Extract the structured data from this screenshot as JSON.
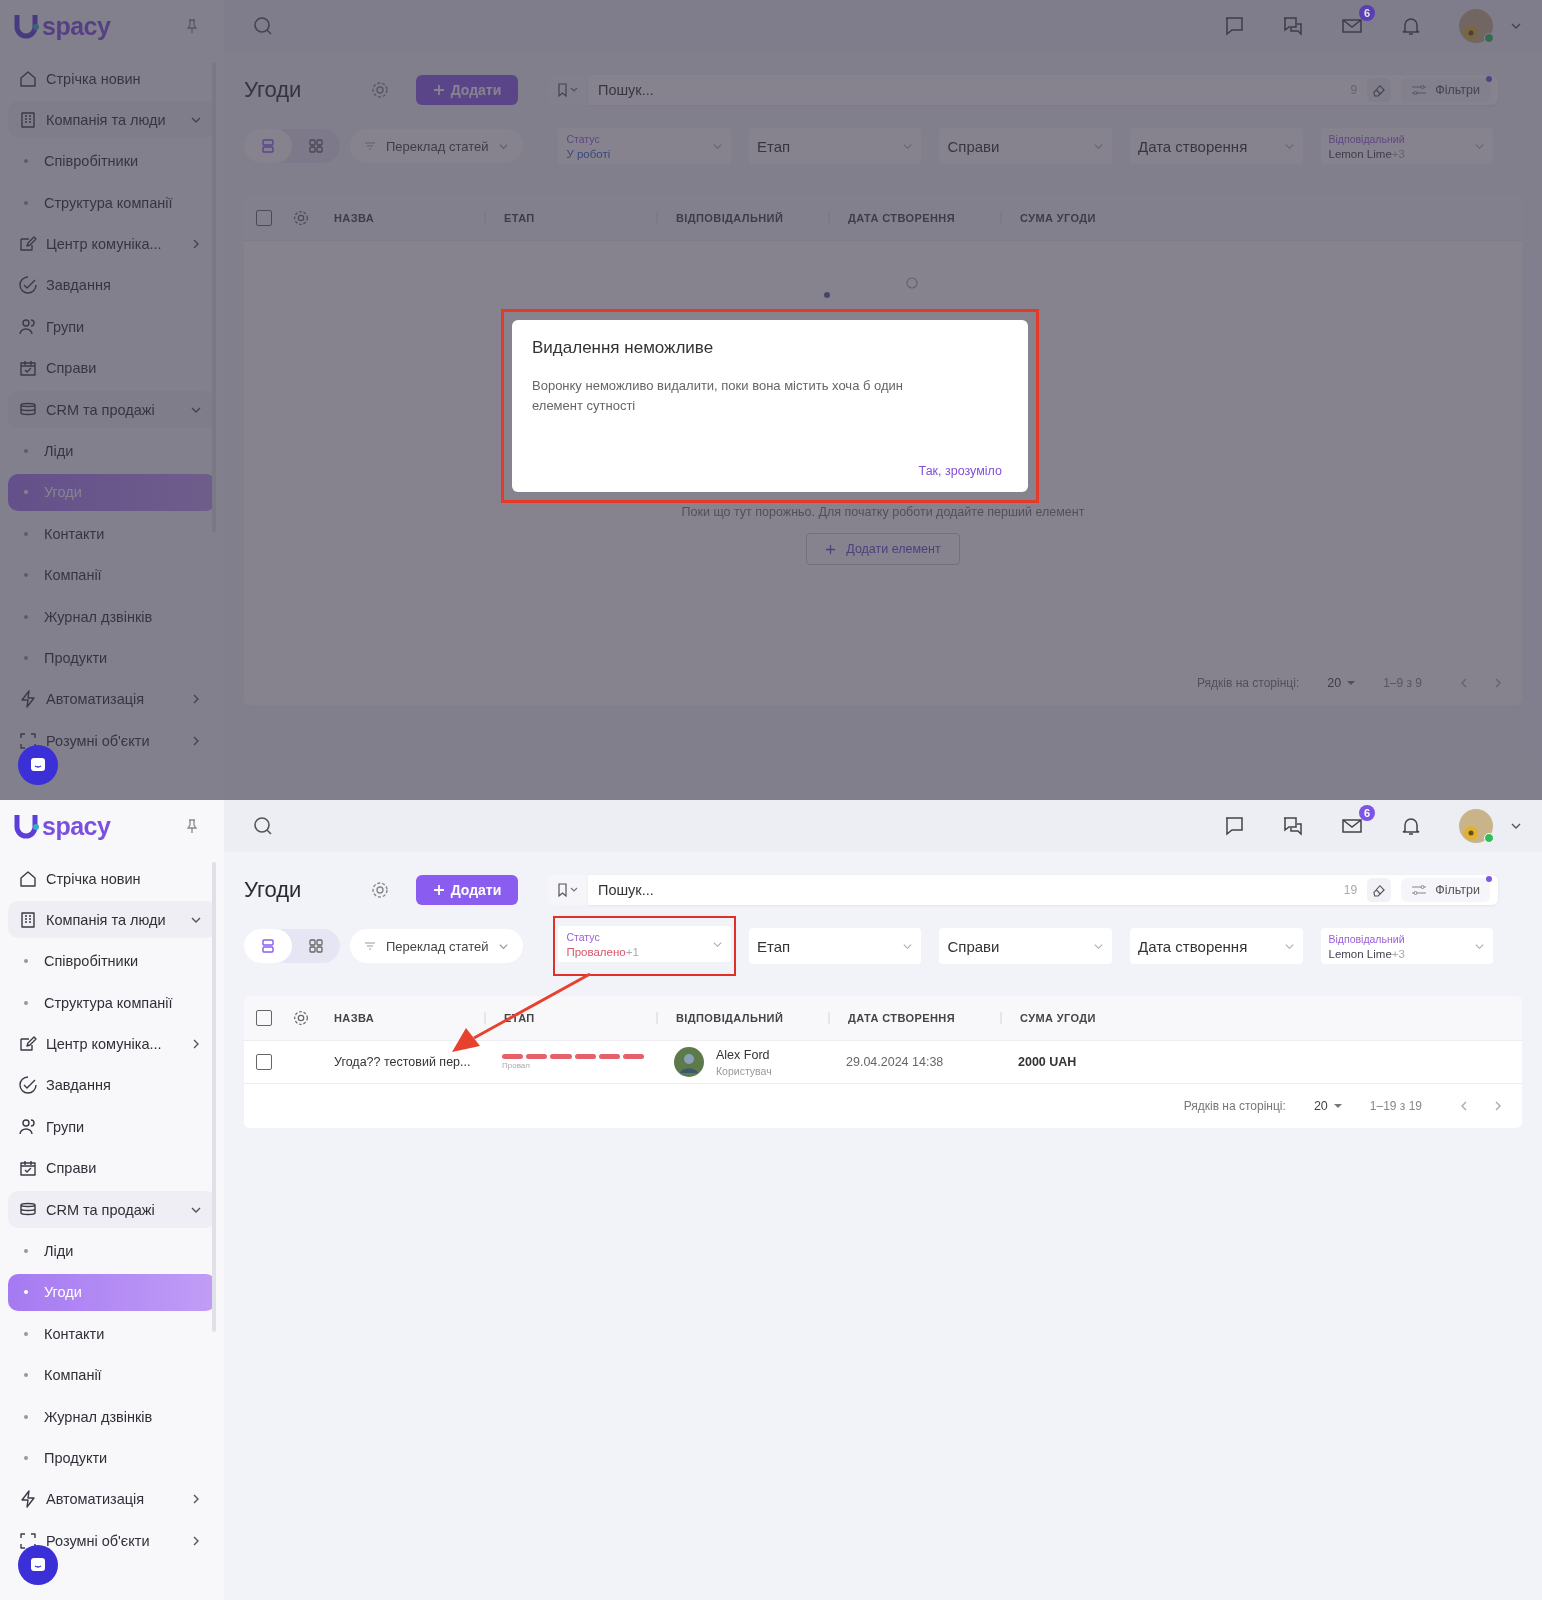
{
  "screens": [
    {
      "dimmed": true,
      "logo": {
        "text": "spacy"
      },
      "sidebar": {
        "items": [
          {
            "kind": "link",
            "label": "Стрічка новин",
            "selected": false
          },
          {
            "kind": "group",
            "label": "Компанія та люди",
            "expanded": true,
            "selected": false
          },
          {
            "kind": "sub",
            "label": "Співробітники",
            "selected": false
          },
          {
            "kind": "sub",
            "label": "Структура компанії",
            "selected": false
          },
          {
            "kind": "group",
            "label": "Центр комуніка...",
            "expanded": false,
            "selected": false
          },
          {
            "kind": "link",
            "label": "Завдання",
            "selected": false
          },
          {
            "kind": "link",
            "label": "Групи",
            "selected": false
          },
          {
            "kind": "link",
            "label": "Справи",
            "selected": false
          },
          {
            "kind": "group",
            "label": "CRM та продажі",
            "expanded": true,
            "selected": false
          },
          {
            "kind": "sub",
            "label": "Ліди",
            "selected": false
          },
          {
            "kind": "sub",
            "label": "Угоди",
            "selected": true
          },
          {
            "kind": "sub",
            "label": "Контакти",
            "selected": false
          },
          {
            "kind": "sub",
            "label": "Компанії",
            "selected": false
          },
          {
            "kind": "sub",
            "label": "Журнал дзвінків",
            "selected": false
          },
          {
            "kind": "sub",
            "label": "Продукти",
            "selected": false
          },
          {
            "kind": "group",
            "label": "Автоматизація",
            "expanded": false,
            "selected": false
          },
          {
            "kind": "group",
            "label": "Розумні об'єкти",
            "expanded": false,
            "selected": false
          }
        ]
      },
      "header": {
        "mail_badge": "6",
        "user": {
          "online": true
        }
      },
      "page": {
        "title": "Угоди",
        "add_button": "Додати",
        "search": {
          "placeholder": "Пошук...",
          "count": "9"
        },
        "filters_button": {
          "label": "Фільтри",
          "active": true
        },
        "view_toggle": [
          {
            "kind": "list",
            "selected": true
          },
          {
            "kind": "grid",
            "selected": false
          }
        ],
        "pipeline": "Переклад статей",
        "filters": [
          {
            "kind": "set",
            "label": "Статус",
            "value": "У роботі",
            "highlighted": false
          },
          {
            "kind": "empty",
            "label": "Етап"
          },
          {
            "kind": "empty",
            "label": "Справи"
          },
          {
            "kind": "empty",
            "label": "Дата створення"
          },
          {
            "kind": "set",
            "label": "Відповідальний",
            "value": "Lemon Lime",
            "extra": "+3",
            "color": "#444450",
            "highlighted": false
          }
        ]
      },
      "table": {
        "all_checked": false,
        "columns": [
          "НАЗВА",
          "ЕТАП",
          "ВІДПОВІДАЛЬНИЙ",
          "ДАТА СТВОРЕННЯ",
          "СУМА УГОДИ"
        ],
        "empty_state": {
          "text": "Поки що тут порожньо. Для початку роботи додайте перший елемент",
          "button": "Додати елемент"
        },
        "pagination": {
          "label": "Рядків на сторінці:",
          "per_page": "20",
          "range": "1–9 з 9"
        }
      },
      "modal": {
        "title": "Видалення неможливе",
        "text": "Воронку неможливо видалити, поки вона містить хоча б один елемент сутності",
        "button": "Так, зрозуміло",
        "highlighted": true
      }
    },
    {
      "dimmed": false,
      "logo": {
        "text": "spacy"
      },
      "sidebar": {
        "items": [
          {
            "kind": "link",
            "label": "Стрічка новин",
            "selected": false
          },
          {
            "kind": "group",
            "label": "Компанія та люди",
            "expanded": true,
            "selected": false
          },
          {
            "kind": "sub",
            "label": "Співробітники",
            "selected": false
          },
          {
            "kind": "sub",
            "label": "Структура компанії",
            "selected": false
          },
          {
            "kind": "group",
            "label": "Центр комуніка...",
            "expanded": false,
            "selected": false
          },
          {
            "kind": "link",
            "label": "Завдання",
            "selected": false
          },
          {
            "kind": "link",
            "label": "Групи",
            "selected": false
          },
          {
            "kind": "link",
            "label": "Справи",
            "selected": false
          },
          {
            "kind": "group",
            "label": "CRM та продажі",
            "expanded": true,
            "selected": false
          },
          {
            "kind": "sub",
            "label": "Ліди",
            "selected": false
          },
          {
            "kind": "sub",
            "label": "Угоди",
            "selected": true
          },
          {
            "kind": "sub",
            "label": "Контакти",
            "selected": false
          },
          {
            "kind": "sub",
            "label": "Компанії",
            "selected": false
          },
          {
            "kind": "sub",
            "label": "Журнал дзвінків",
            "selected": false
          },
          {
            "kind": "sub",
            "label": "Продукти",
            "selected": false
          },
          {
            "kind": "group",
            "label": "Автоматизація",
            "expanded": false,
            "selected": false
          },
          {
            "kind": "group",
            "label": "Розумні об'єкти",
            "expanded": false,
            "selected": false
          }
        ]
      },
      "header": {
        "mail_badge": "6",
        "user": {
          "online": true
        }
      },
      "page": {
        "title": "Угоди",
        "add_button": "Додати",
        "search": {
          "placeholder": "Пошук...",
          "count": "19"
        },
        "filters_button": {
          "label": "Фільтри",
          "active": true
        },
        "view_toggle": [
          {
            "kind": "list",
            "selected": true
          },
          {
            "kind": "grid",
            "selected": false
          }
        ],
        "pipeline": "Переклад статей",
        "filters": [
          {
            "kind": "set",
            "label": "Статус",
            "value": "Провалено",
            "extra": "+1",
            "color": "#d9556a",
            "highlighted": true
          },
          {
            "kind": "empty",
            "label": "Етап"
          },
          {
            "kind": "empty",
            "label": "Справи"
          },
          {
            "kind": "empty",
            "label": "Дата створення"
          },
          {
            "kind": "set",
            "label": "Відповідальний",
            "value": "Lemon Lime",
            "extra": "+3",
            "color": "#444450",
            "highlighted": false
          }
        ]
      },
      "table": {
        "all_checked": false,
        "columns": [
          "НАЗВА",
          "ЕТАП",
          "ВІДПОВІДАЛЬНИЙ",
          "ДАТА СТВОРЕННЯ",
          "СУМА УГОДИ"
        ],
        "rows": [
          {
            "checked": false,
            "pointed": true,
            "name": "Угода?? тестовий пер...",
            "stage": {
              "label": "Провал",
              "color": "#e5606a",
              "steps": [
                {
                  "done": true
                },
                {
                  "done": true
                },
                {
                  "done": true
                },
                {
                  "done": true
                },
                {
                  "done": true
                },
                {
                  "done": true
                }
              ]
            },
            "responsible": {
              "name": "Alex Ford",
              "role": "Користувач"
            },
            "date": "29.04.2024 14:38",
            "sum": "2000 UAH"
          }
        ],
        "pagination": {
          "label": "Рядків на сторінці:",
          "per_page": "20",
          "range": "1–19 з 19"
        }
      }
    }
  ]
}
